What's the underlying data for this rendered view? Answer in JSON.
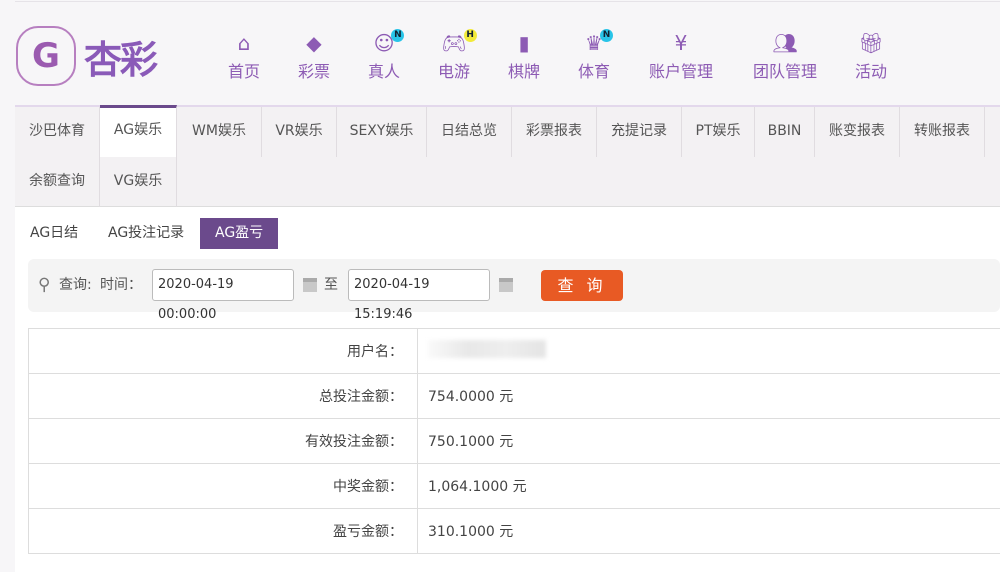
{
  "brand": {
    "name": "杏彩"
  },
  "nav": [
    {
      "label": "首页",
      "icon": "home-icon"
    },
    {
      "label": "彩票",
      "icon": "ticket-icon"
    },
    {
      "label": "真人",
      "icon": "dealer-icon",
      "badge": "N"
    },
    {
      "label": "电游",
      "icon": "gamepad-icon",
      "badge": "H"
    },
    {
      "label": "棋牌",
      "icon": "cards-icon"
    },
    {
      "label": "体育",
      "icon": "trophy-icon",
      "badge": "N"
    },
    {
      "label": "账户管理",
      "icon": "yen-icon"
    },
    {
      "label": "团队管理",
      "icon": "team-icon"
    },
    {
      "label": "活动",
      "icon": "gift-icon"
    }
  ],
  "tabs": [
    "沙巴体育",
    "AG娱乐",
    "WM娱乐",
    "VR娱乐",
    "SEXY娱乐",
    "日结总览",
    "彩票报表",
    "充提记录",
    "PT娱乐",
    "BBIN",
    "账变报表",
    "转账报表",
    "余额查询",
    "VG娱乐"
  ],
  "subtabs": [
    "AG日结",
    "AG投注记录",
    "AG盈亏"
  ],
  "search": {
    "label": "查询:",
    "time_label": "时间：",
    "start": "2020-04-19 00:00:00",
    "to": "至",
    "end": "2020-04-19 15:19:46",
    "button": "查 询"
  },
  "rows": [
    {
      "label": "用户名：",
      "value": ""
    },
    {
      "label": "总投注金额：",
      "value": "754.0000 元"
    },
    {
      "label": "有效投注金额：",
      "value": "750.1000 元"
    },
    {
      "label": "中奖金额：",
      "value": "1,064.1000 元"
    },
    {
      "label": "盈亏金额：",
      "value": "310.1000 元"
    }
  ],
  "colors": {
    "accent": "#6b4a8c",
    "button": "#e85a24",
    "nav": "#8d5bb4"
  }
}
